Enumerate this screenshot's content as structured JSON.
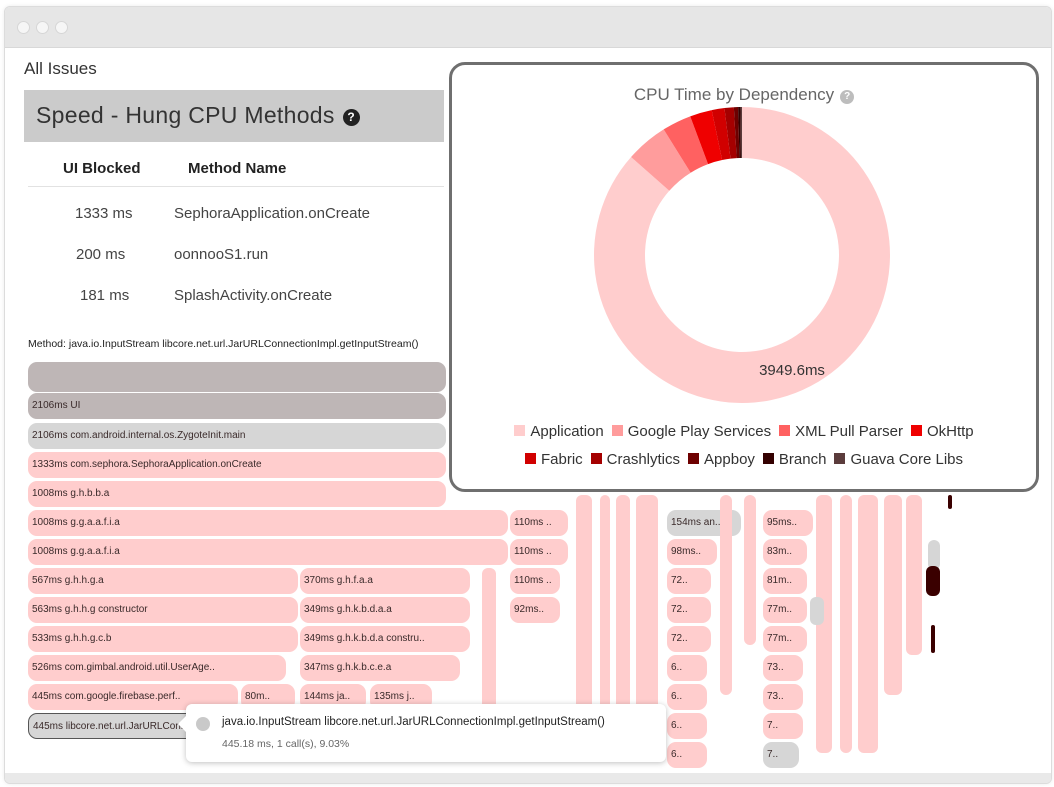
{
  "page": {
    "all_issues": "All Issues",
    "section_title": "Speed - Hung CPU Methods",
    "help_glyph": "?"
  },
  "table": {
    "columns": [
      "UI Blocked",
      "Method Name"
    ],
    "rows": [
      {
        "blocked": "1333 ms",
        "method": "SephoraApplication.onCreate"
      },
      {
        "blocked": "200 ms",
        "method": "oonnooS1.run"
      },
      {
        "blocked": "181 ms",
        "method": "SplashActivity.onCreate"
      }
    ]
  },
  "method_label": "Method: java.io.InputStream libcore.net.url.JarURLConnectionImpl.getInputStream()",
  "flame": {
    "rows": [
      {
        "label": ""
      },
      {
        "label": "2106ms UI"
      },
      {
        "label": "2106ms com.android.internal.os.ZygoteInit.main"
      },
      {
        "label": "1333ms com.sephora.SephoraApplication.onCreate"
      },
      {
        "label": "1008ms g.h.b.b.a"
      },
      {
        "label": "1008ms g.g.a.a.f.i.a"
      },
      {
        "label": "1008ms g.g.a.a.f.i.a"
      },
      {
        "label": "567ms g.h.h.g.a"
      },
      {
        "label": "563ms g.h.h.g constructor"
      },
      {
        "label": "533ms g.h.h.g.c.b"
      },
      {
        "label": "526ms com.gimbal.android.util.UserAge.."
      },
      {
        "label": "445ms com.google.firebase.perf.."
      },
      {
        "label": "445ms libcore.net.url.JarURLConnectionImpl.getInputStream()"
      }
    ],
    "blocks": [
      "110ms ..",
      "154ms an..",
      "95ms..",
      "110ms ..",
      "98ms..",
      "83m..",
      "370ms g.h.f.a.a",
      "110ms ..",
      "72..",
      "81m..",
      "349ms g.h.k.b.d.a.a",
      "92ms..",
      "72..",
      "77m..",
      "349ms g.h.k.b.d.a constru..",
      "72..",
      "77m..",
      "347ms g.h.k.b.c.e.a",
      "6..",
      "73..",
      "80m..",
      "144ms ja..",
      "135ms j..",
      "6..",
      "73..",
      "6..",
      "7..",
      "6..",
      "7.."
    ]
  },
  "chart_data": {
    "type": "pie",
    "title": "CPU Time by Dependency",
    "center_label": "3949.6ms",
    "categories": [
      "Application",
      "Google Play Services",
      "XML Pull Parser",
      "OkHttp",
      "Fabric",
      "Crashlytics",
      "Appboy",
      "Branch",
      "Guava Core Libs"
    ],
    "values": [
      3417.0,
      182.0,
      126.0,
      95.0,
      55.0,
      40.0,
      18.0,
      10.0,
      6.6
    ],
    "colors": [
      "#ffcdcd",
      "#ff9c9c",
      "#ff6161",
      "#ef0000",
      "#d10000",
      "#a50000",
      "#6e0000",
      "#340000",
      "#5b3c3c"
    ],
    "legend_position": "bottom"
  },
  "tooltip": {
    "title": "java.io.InputStream libcore.net.url.JarURLConnectionImpl.getInputStream()",
    "detail": "445.18 ms, 1 call(s), 9.03%"
  }
}
